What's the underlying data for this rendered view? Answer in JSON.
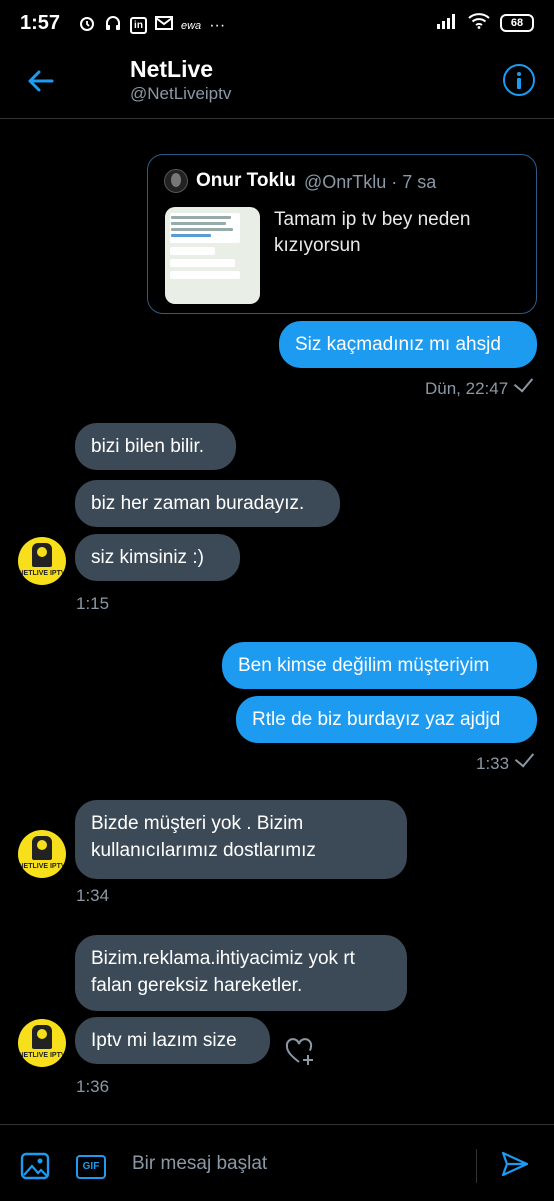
{
  "status_bar": {
    "time": "1:57",
    "ewa": "ewa",
    "dots": "···",
    "battery": "68"
  },
  "header": {
    "title": "NetLive",
    "handle": "@NetLiveiptv"
  },
  "quoted_tweet": {
    "name": "Onur Toklu",
    "handle_time": "@OnrTklu · 7 sa",
    "text": "Tamam ip tv bey neden kızıyorsun"
  },
  "messages": {
    "m1": "Siz kaçmadınız mı ahsjd",
    "t1": "Dün, 22:47",
    "m2": "bizi bilen bilir.",
    "m3": "biz her zaman buradayız.",
    "m4": "siz kimsiniz  :)",
    "t2": "1:15",
    "m5": "Ben kimse değilim müşteriyim",
    "m6": "Rtle de biz burdayız yaz ajdjd",
    "t3": "1:33",
    "m7_line1": "Bizde müşteri yok . Bizim",
    "m7_line2": "kullanıcılarımız dostlarımız",
    "t4": "1:34",
    "m8_line1": "Bizim.reklama.ihtiyacimiz yok rt",
    "m8_line2": "falan gereksiz hareketler.",
    "m9": "Iptv mi lazım size",
    "t5": "1:36"
  },
  "composer": {
    "placeholder": "Bir mesaj başlat",
    "gif_label": "GIF"
  },
  "avatar_brand": "NETLIVE IPTV",
  "colors": {
    "accent": "#1d9bf0",
    "incoming_bubble": "#3c4a57",
    "muted_text": "#8b98a5",
    "background": "#000000"
  }
}
